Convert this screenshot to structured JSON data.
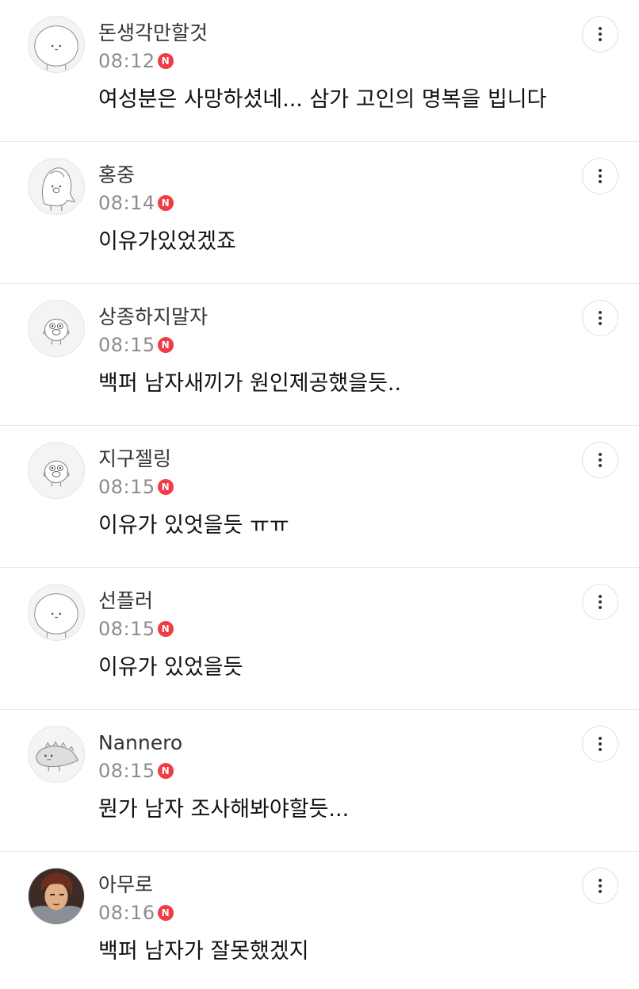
{
  "comments": [
    {
      "author": "돈생각만할것",
      "time": "08:12",
      "badge": "N",
      "text": "여성분은 사망하셨네... 삼가 고인의 명복을 빕니다",
      "avatar": "round-face-character"
    },
    {
      "author": "홍중",
      "time": "08:14",
      "badge": "N",
      "text": "이유가있었겠죠",
      "avatar": "penguin-hood-character"
    },
    {
      "author": "상종하지말자",
      "time": "08:15",
      "badge": "N",
      "text": "백퍼 남자새끼가 원인제공했을듯..",
      "avatar": "pig-character"
    },
    {
      "author": "지구젤링",
      "time": "08:15",
      "badge": "N",
      "text": "이유가 있엇을듯 ㅠㅠ",
      "avatar": "pig-character"
    },
    {
      "author": "선플러",
      "time": "08:15",
      "badge": "N",
      "text": "이유가 있었을듯",
      "avatar": "round-face-character"
    },
    {
      "author": "Nannero",
      "time": "08:15",
      "badge": "N",
      "text": "뭔가 남자 조사해봐야할듯...",
      "avatar": "dinosaur-character"
    },
    {
      "author": "아무로",
      "time": "08:16",
      "badge": "N",
      "text": "백퍼 남자가 잘못했겠지",
      "avatar": "anime-character-photo"
    }
  ],
  "colors": {
    "badge": "#f13b45",
    "time": "#8c8c8c",
    "author": "#333333",
    "text": "#111111",
    "divider": "#e9e9e9"
  }
}
